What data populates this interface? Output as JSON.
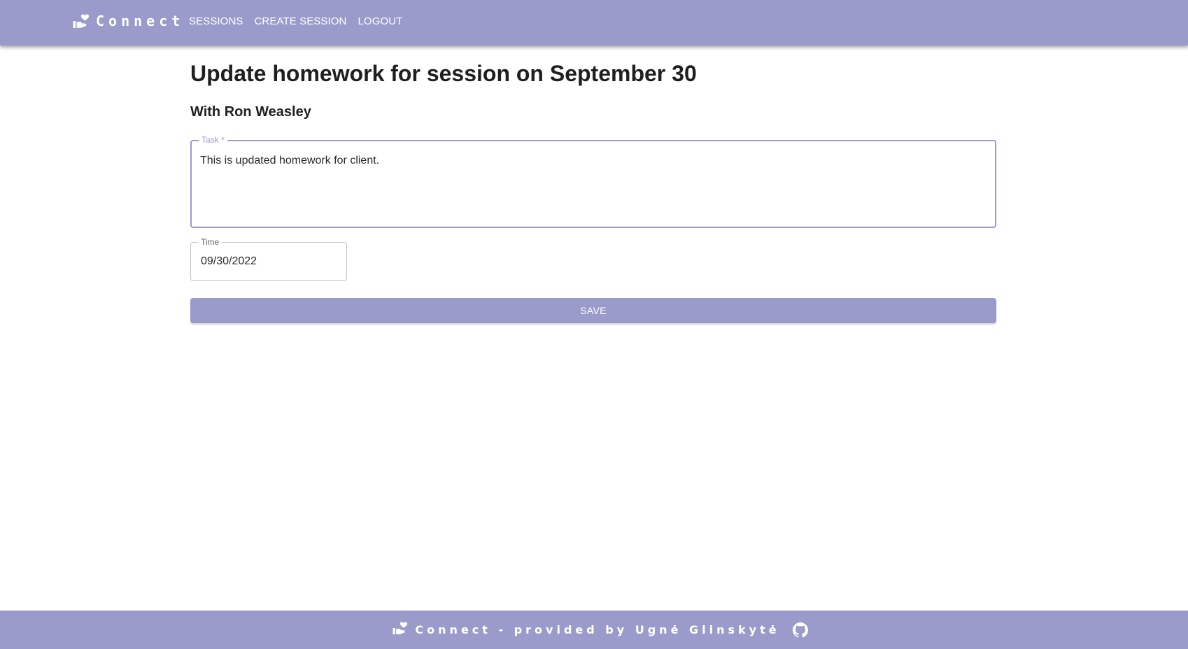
{
  "colors": {
    "accent": "#9a9bcb",
    "text": "#1f1f1f",
    "white": "#ffffff"
  },
  "header": {
    "brand_icon": "hand-heart-icon",
    "brand_name": "Connect",
    "nav": [
      {
        "label": "SESSIONS"
      },
      {
        "label": "CREATE SESSION"
      },
      {
        "label": "LOGOUT"
      }
    ]
  },
  "main": {
    "title": "Update homework for session on September 30",
    "subtitle": "With Ron Weasley",
    "task": {
      "label": "Task *",
      "value": "This is updated homework for client."
    },
    "time": {
      "label": "Time",
      "value": "09/30/2022"
    },
    "save_label": "SAVE"
  },
  "footer": {
    "brand_icon": "hand-heart-icon",
    "text": "Connect - provided by Ugnė Glinskytė",
    "link_icon": "github-icon"
  }
}
